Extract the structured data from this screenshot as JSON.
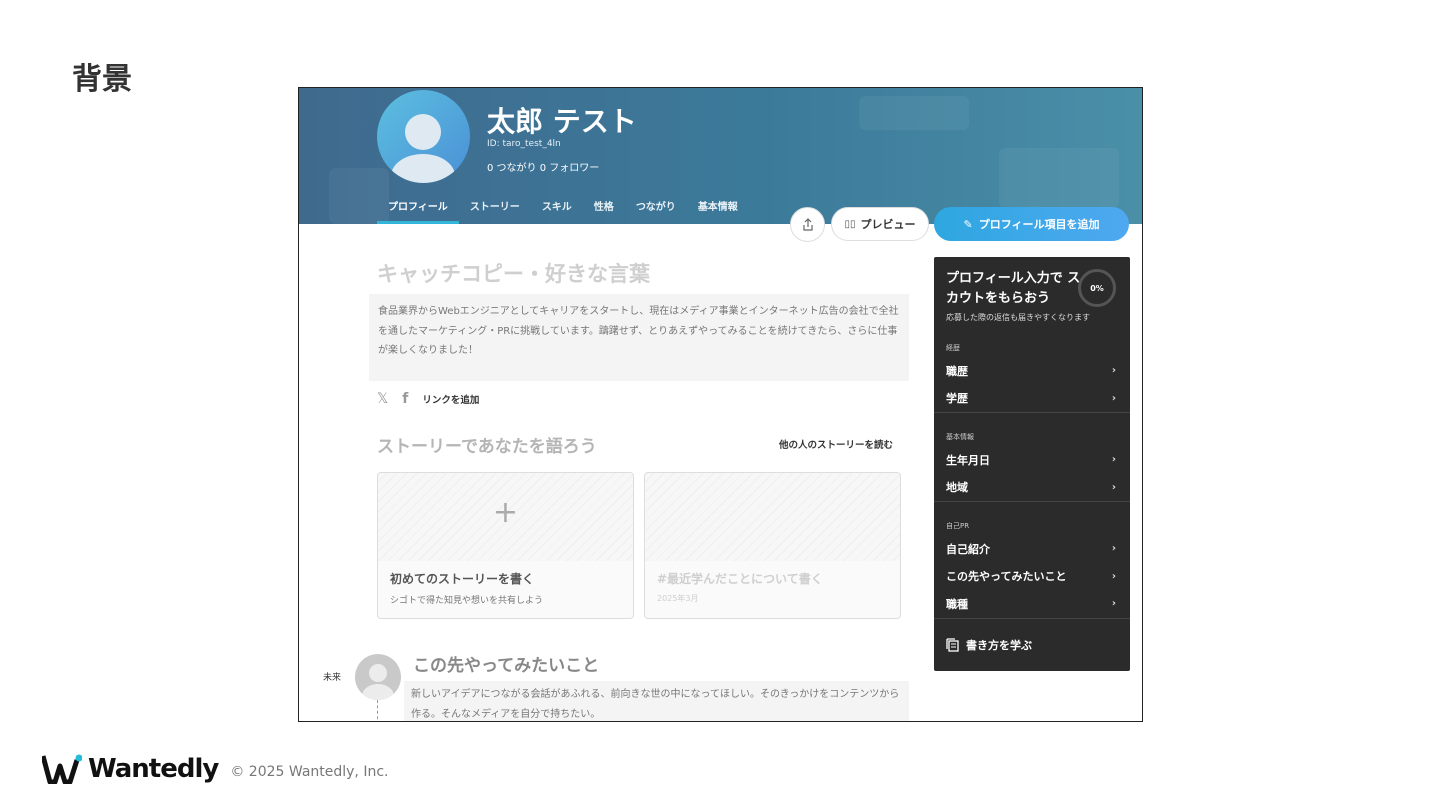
{
  "slide": {
    "title": "背景",
    "footer_logo": "Wantedly",
    "copyright": "© 2025 Wantedly, Inc."
  },
  "profile": {
    "name": "太郎 テスト",
    "user_id": "ID: taro_test_4ln",
    "connections": "0 つながり  0 フォロワー"
  },
  "tabs": [
    {
      "label": "プロフィール",
      "active": true
    },
    {
      "label": "ストーリー"
    },
    {
      "label": "スキル"
    },
    {
      "label": "性格"
    },
    {
      "label": "つながり"
    },
    {
      "label": "基本情報"
    }
  ],
  "actions": {
    "preview_label": "プレビュー",
    "add_label": "プロフィール項目を追加"
  },
  "catchcopy": {
    "title": "キャッチコピー・好きな言葉",
    "body": "食品業界からWebエンジニアとしてキャリアをスタートし、現在はメディア事業とインターネット広告の会社で全社を通したマーケティング・PRに挑戦しています。躊躇せず、とりあえずやってみることを続けてきたら、さらに仕事が楽しくなりました！"
  },
  "social": {
    "x_icon": "𝕏",
    "fb_icon": "f",
    "add_link_label": "リンクを追加"
  },
  "stories": {
    "heading": "ストーリーであなたを語ろう",
    "others_link": "他の人のストーリーを読む",
    "cards": [
      {
        "title": "初めてのストーリーを書く",
        "sub": "シゴトで得た知見や想いを共有しよう",
        "plus": "+"
      },
      {
        "title": "#最近学んだことについて書く",
        "sub": "2025年3月"
      }
    ]
  },
  "future": {
    "label": "未来",
    "title": "この先やってみたいこと",
    "body": "新しいアイデアにつながる会話があふれる、前向きな世の中になってほしい。そのきっかけをコンテンツから作る。そんなメディアを自分で持ちたい。"
  },
  "panel": {
    "title": "プロフィール入力で スカウトをもらおう",
    "progress": "0%",
    "progress_value": 0,
    "subtitle": "応募した際の返信も届きやすくなります",
    "sections": [
      {
        "label": "経歴",
        "items": [
          "職歴",
          "学歴"
        ]
      },
      {
        "label": "基本情報",
        "items": [
          "生年月日",
          "地域"
        ]
      },
      {
        "label": "自己PR",
        "items": [
          "自己紹介",
          "この先やってみたいこと",
          "職種"
        ]
      }
    ],
    "learn_label": "書き方を学ぶ"
  },
  "colors": {
    "accent": "#2ea7e0",
    "header_bg": "#3f6a8e",
    "panel_bg": "#2b2b2b"
  }
}
